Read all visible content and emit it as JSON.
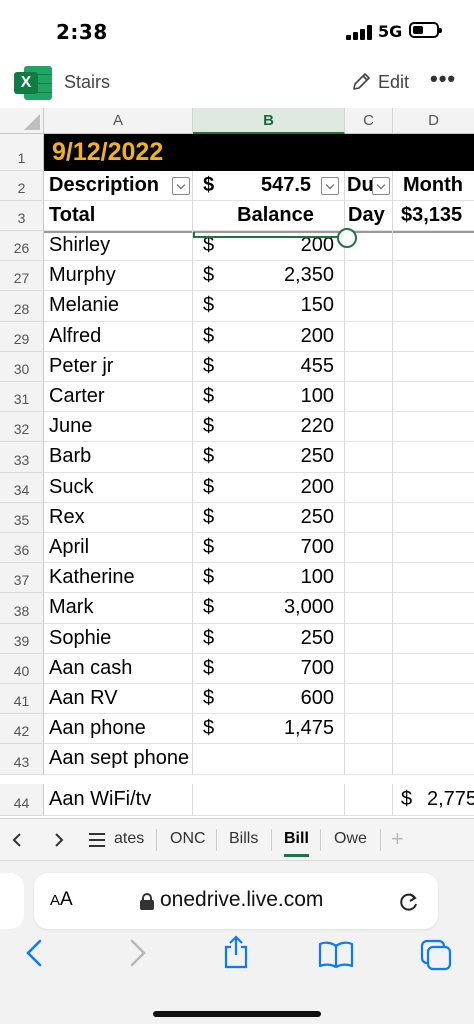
{
  "status_bar": {
    "time": "2:38",
    "network": "5G"
  },
  "app": {
    "title": "Stairs",
    "edit_label": "Edit",
    "more": "•••"
  },
  "columns": [
    "A",
    "B",
    "C",
    "D"
  ],
  "rows": {
    "r1": {
      "num": "1",
      "date": "9/12/2022"
    },
    "r2": {
      "num": "2",
      "a": "Description",
      "b_sym": "$",
      "b_val": "547.5",
      "c": "Du",
      "d": "Month"
    },
    "r3": {
      "num": "3",
      "a": "Total",
      "b": "Balance",
      "c": "Day",
      "d": "$3,135"
    }
  },
  "data_rows": [
    {
      "num": "26",
      "name": "Shirley",
      "sym": "$",
      "amount": "200"
    },
    {
      "num": "27",
      "name": "Murphy",
      "sym": "$",
      "amount": "2,350"
    },
    {
      "num": "28",
      "name": "Melanie",
      "sym": "$",
      "amount": "150"
    },
    {
      "num": "29",
      "name": "Alfred",
      "sym": "$",
      "amount": "200"
    },
    {
      "num": "30",
      "name": "Peter jr",
      "sym": "$",
      "amount": "455"
    },
    {
      "num": "31",
      "name": "Carter",
      "sym": "$",
      "amount": "100"
    },
    {
      "num": "32",
      "name": "June",
      "sym": "$",
      "amount": "220"
    },
    {
      "num": "33",
      "name": "Barb",
      "sym": "$",
      "amount": "250"
    },
    {
      "num": "34",
      "name": "Suck",
      "sym": "$",
      "amount": "200"
    },
    {
      "num": "35",
      "name": "Rex",
      "sym": "$",
      "amount": "250"
    },
    {
      "num": "36",
      "name": "April",
      "sym": "$",
      "amount": "700"
    },
    {
      "num": "37",
      "name": "Katherine",
      "sym": "$",
      "amount": "100"
    },
    {
      "num": "38",
      "name": "Mark",
      "sym": "$",
      "amount": "3,000"
    },
    {
      "num": "39",
      "name": "Sophie",
      "sym": "$",
      "amount": "250"
    },
    {
      "num": "40",
      "name": "Aan cash",
      "sym": "$",
      "amount": "700"
    },
    {
      "num": "41",
      "name": "Aan RV",
      "sym": "$",
      "amount": "600"
    },
    {
      "num": "42",
      "name": "Aan phone",
      "sym": "$",
      "amount": "1,475"
    },
    {
      "num": "43",
      "name": "Aan sept phone",
      "sym": "",
      "amount": ""
    }
  ],
  "row44": {
    "num": "44",
    "name": "Aan WiFi/tv",
    "d_sym": "$",
    "d_val": "2,775"
  },
  "sheet_tabs": [
    "ates",
    "ONC",
    "Bills",
    "Bill",
    "Owe"
  ],
  "active_tab": "Bill",
  "browser": {
    "text_size": "AA",
    "url": "onedrive.live.com"
  },
  "colors": {
    "excel_green": "#217346",
    "date_text": "#f3b21b",
    "ios_blue": "#0a7aff"
  }
}
